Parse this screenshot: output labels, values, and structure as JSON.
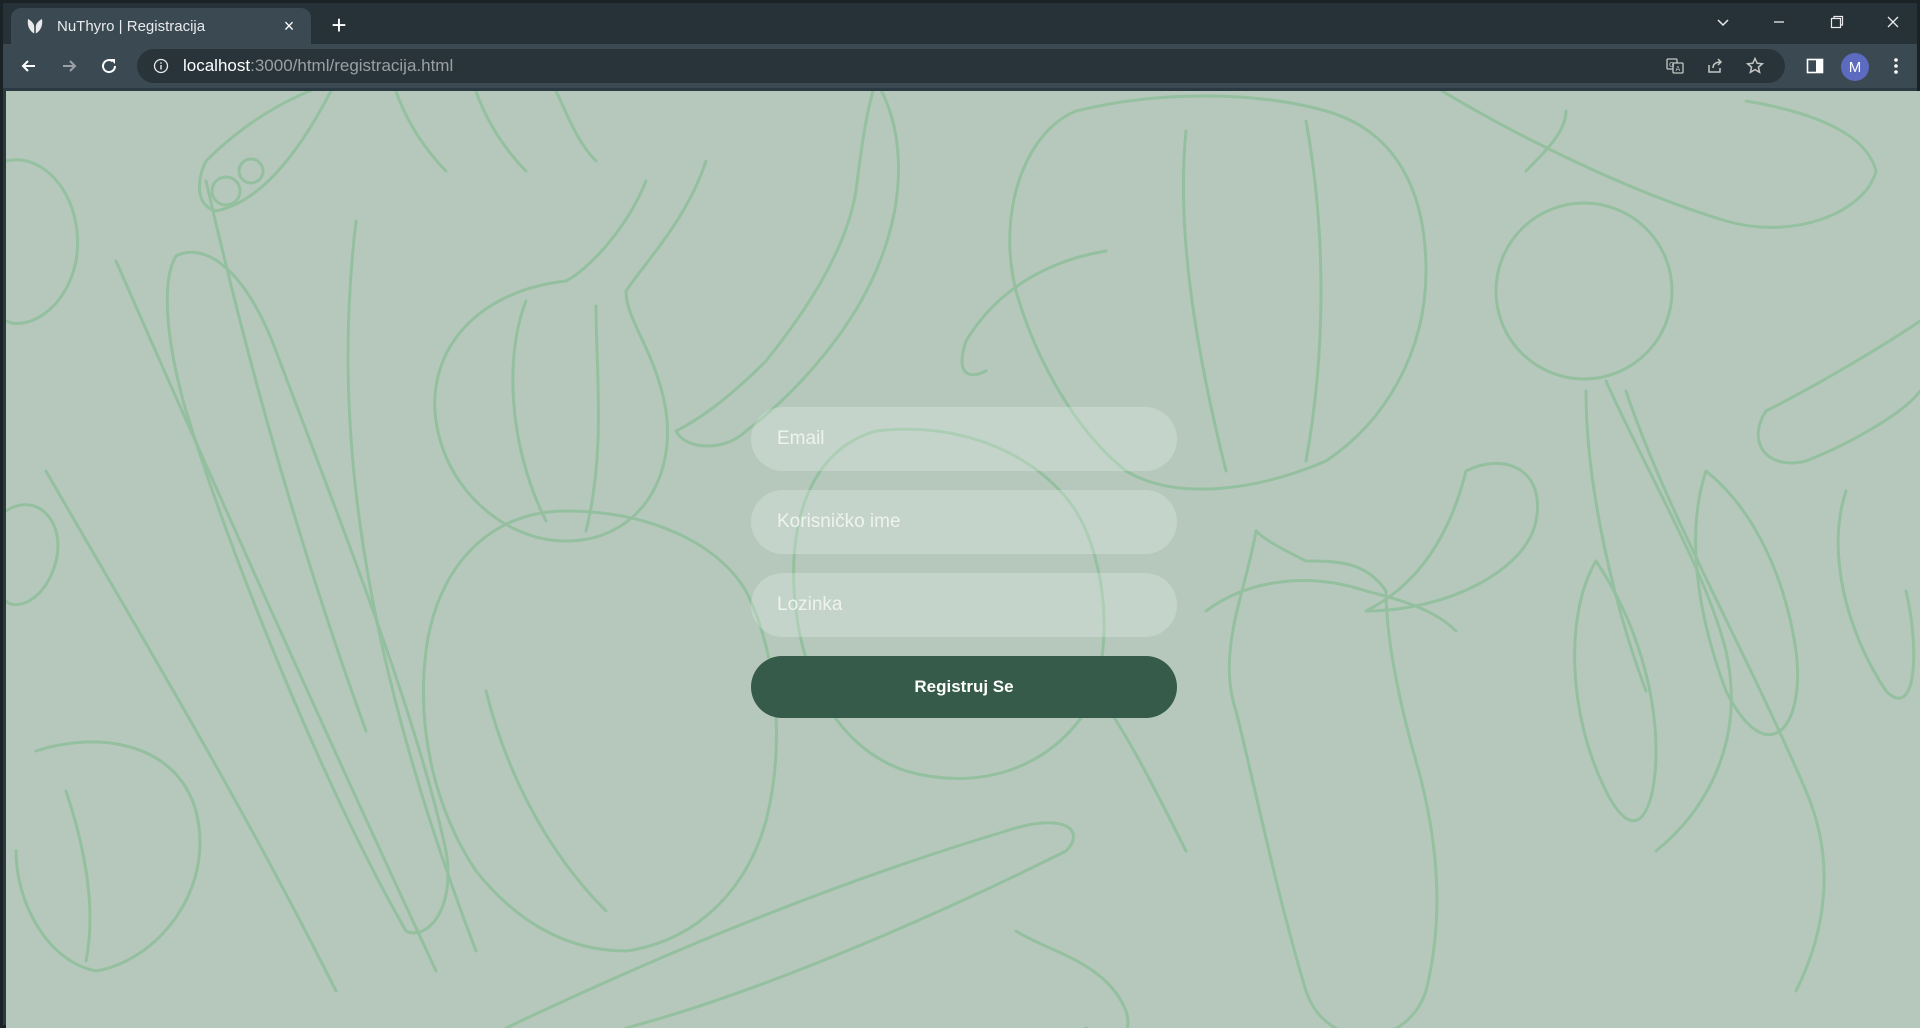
{
  "browser": {
    "tab": {
      "title": "NuThyro | Registracija",
      "favicon": "leaf-icon",
      "close": "×"
    },
    "new_tab": "+",
    "window_controls": [
      "chevron-down-icon",
      "minimize-icon",
      "restore-icon",
      "close-icon"
    ],
    "address": {
      "host": "localhost",
      "path": ":3000/html/registracija.html"
    },
    "avatar_letter": "M",
    "toolbar_icons": [
      "back-icon",
      "forward-icon",
      "reload-icon",
      "info-icon",
      "translate-icon",
      "share-icon",
      "star-icon",
      "side-panel-icon",
      "more-vert-icon"
    ]
  },
  "page": {
    "background_color": "#b5c8bb",
    "illustration_color": "#8fbf9c",
    "form": {
      "email_placeholder": "Email",
      "username_placeholder": "Korisničko ime",
      "password_placeholder": "Lozinka",
      "submit_label": "Registruj Se",
      "submit_color": "#365b4a"
    }
  }
}
